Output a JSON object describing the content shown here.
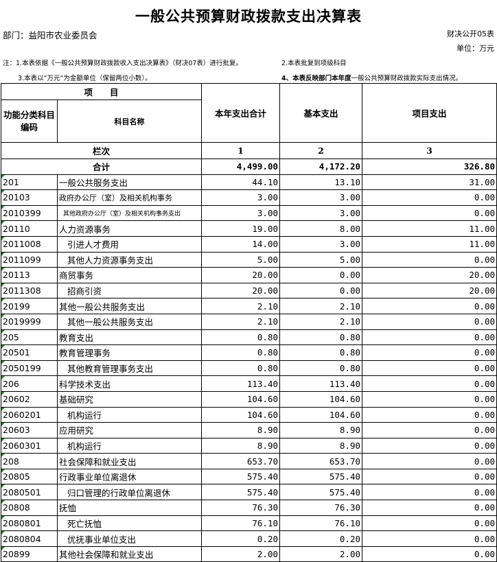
{
  "title": "一般公共预算财政拨款支出决算表",
  "department": "部门：益阳市农业委员会",
  "form_no": "财决公开05表",
  "unit": "单位：万元",
  "notes": {
    "note1": "注：1.本表依据《一般公共预算财政拨款收入支出决算表》（财决07表）进行批复。",
    "note2": "2.本表批复到项级科目",
    "note3": "3.本表以“万元”为金额单位（保留两位小数）。",
    "note4_bold": "4、本表反映部门本年度",
    "note4_rest": "一般公共预算财政拨款实际支出情况。"
  },
  "header": {
    "item": "项　　目",
    "func_code": "功能分类科目编码",
    "subject_name": "科目名称",
    "total_col": "本年支出合计",
    "basic_col": "基本支出",
    "project_col": "项目支出",
    "seq_label": "栏次",
    "seq1": "1",
    "seq2": "2",
    "seq3": "3"
  },
  "total": {
    "label": "合计",
    "total": "4,499.00",
    "basic": "4,172.20",
    "project": "326.80"
  },
  "rows": [
    {
      "code": "201",
      "name": "一般公共服务支出",
      "total": "44.10",
      "basic": "13.10",
      "project": "31.00"
    },
    {
      "code": "20103",
      "name": "政府办公厅（室）及相关机构事务",
      "total": "3.00",
      "basic": "3.00",
      "project": "0.00"
    },
    {
      "code": "2010399",
      "name": "其他政府办公厅（室）及相关机构事务支出",
      "total": "3.00",
      "basic": "3.00",
      "project": "0.00"
    },
    {
      "code": "20110",
      "name": "人力资源事务",
      "total": "19.00",
      "basic": "8.00",
      "project": "11.00"
    },
    {
      "code": "2011008",
      "name": "引进人才费用",
      "total": "14.00",
      "basic": "3.00",
      "project": "11.00"
    },
    {
      "code": "2011099",
      "name": "其他人力资源事务支出",
      "total": "5.00",
      "basic": "5.00",
      "project": "0.00"
    },
    {
      "code": "20113",
      "name": "商贸事务",
      "total": "20.00",
      "basic": "0.00",
      "project": "20.00"
    },
    {
      "code": "2011308",
      "name": "招商引资",
      "total": "20.00",
      "basic": "0.00",
      "project": "20.00"
    },
    {
      "code": "20199",
      "name": "其他一般公共服务支出",
      "total": "2.10",
      "basic": "2.10",
      "project": "0.00"
    },
    {
      "code": "2019999",
      "name": "其他一般公共服务支出",
      "total": "2.10",
      "basic": "2.10",
      "project": "0.00"
    },
    {
      "code": "205",
      "name": "教育支出",
      "total": "0.80",
      "basic": "0.80",
      "project": "0.00"
    },
    {
      "code": "20501",
      "name": "教育管理事务",
      "total": "0.80",
      "basic": "0.80",
      "project": "0.00"
    },
    {
      "code": "2050199",
      "name": "其他教育管理事务支出",
      "total": "0.80",
      "basic": "0.80",
      "project": "0.00"
    },
    {
      "code": "206",
      "name": "科学技术支出",
      "total": "113.40",
      "basic": "113.40",
      "project": "0.00"
    },
    {
      "code": "20602",
      "name": "基础研究",
      "total": "104.60",
      "basic": "104.60",
      "project": "0.00"
    },
    {
      "code": "2060201",
      "name": "机构运行",
      "total": "104.60",
      "basic": "104.60",
      "project": "0.00"
    },
    {
      "code": "20603",
      "name": "应用研究",
      "total": "8.90",
      "basic": "8.90",
      "project": "0.00"
    },
    {
      "code": "2060301",
      "name": "机构运行",
      "total": "8.90",
      "basic": "8.90",
      "project": "0.00"
    },
    {
      "code": "208",
      "name": "社会保障和就业支出",
      "total": "653.70",
      "basic": "653.70",
      "project": "0.00"
    },
    {
      "code": "20805",
      "name": "行政事业单位离退休",
      "total": "575.40",
      "basic": "575.40",
      "project": "0.00"
    },
    {
      "code": "2080501",
      "name": "归口管理的行政单位离退休",
      "total": "575.40",
      "basic": "575.40",
      "project": "0.00"
    },
    {
      "code": "20808",
      "name": "抚恤",
      "total": "76.30",
      "basic": "76.30",
      "project": "0.00"
    },
    {
      "code": "2080801",
      "name": "死亡抚恤",
      "total": "76.10",
      "basic": "76.10",
      "project": "0.00"
    },
    {
      "code": "2080804",
      "name": "优抚事业单位支出",
      "total": "0.20",
      "basic": "0.20",
      "project": "0.00"
    },
    {
      "code": "20899",
      "name": "其他社会保障和就业支出",
      "total": "2.00",
      "basic": "2.00",
      "project": "0.00"
    }
  ]
}
